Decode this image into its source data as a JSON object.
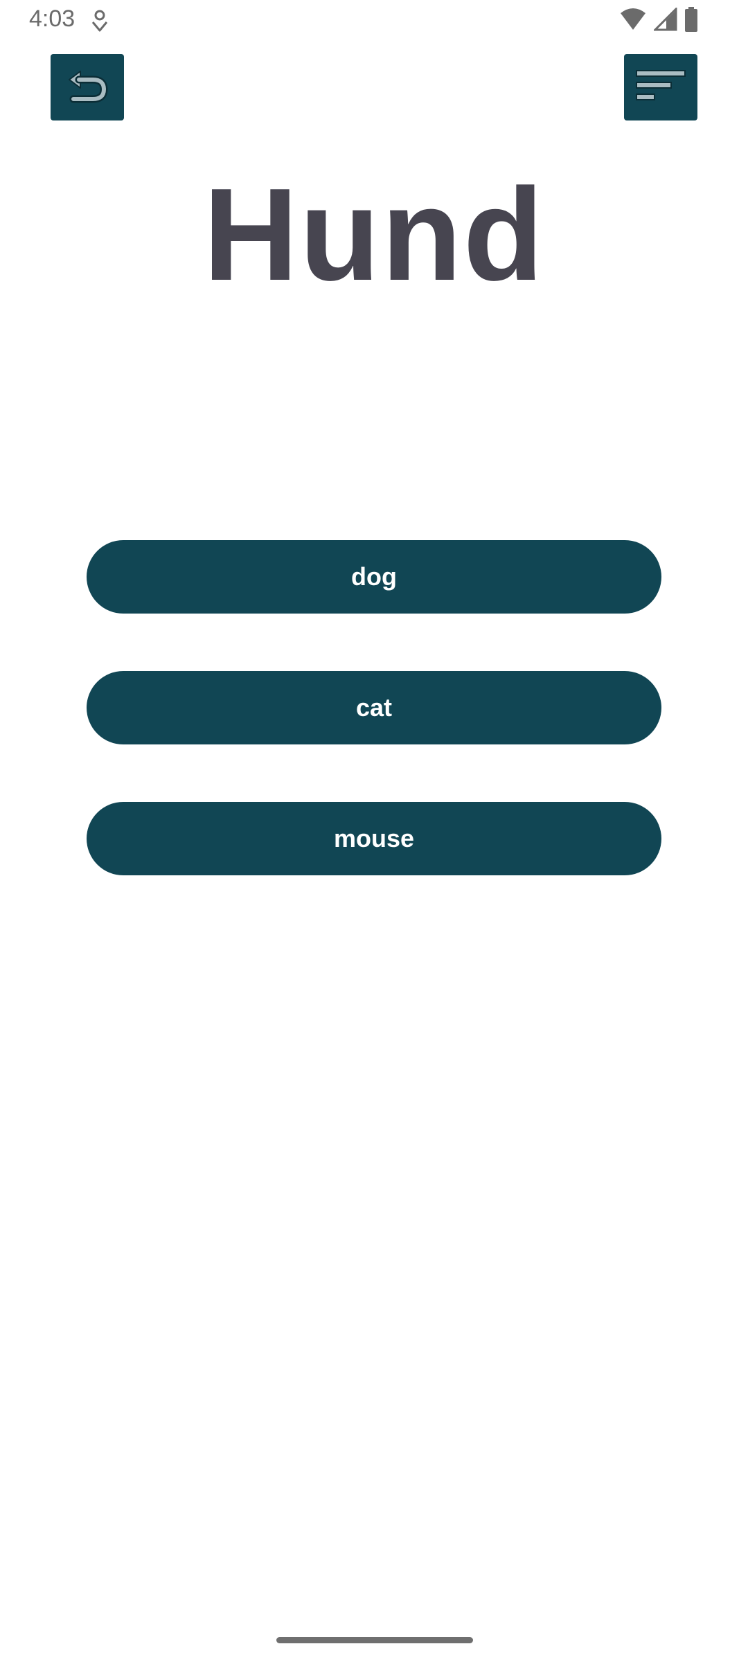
{
  "status_bar": {
    "time": "4:03",
    "icons": [
      "notification-icon",
      "wifi-icon",
      "cellular-signal-icon",
      "battery-icon"
    ]
  },
  "toolbar": {
    "back_icon": "undo-arrow-icon",
    "menu_icon": "sort-lines-icon"
  },
  "quiz": {
    "word": "Hund",
    "choices": [
      {
        "label": "dog"
      },
      {
        "label": "cat"
      },
      {
        "label": "mouse"
      }
    ]
  },
  "colors": {
    "accent": "#114654",
    "title_text": "#474550",
    "button_text": "#ffffff",
    "background": "#ffffff"
  }
}
